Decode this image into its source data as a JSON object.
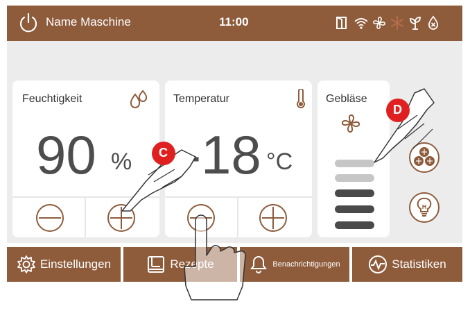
{
  "header": {
    "machine_name": "Name Maschine",
    "time": "11:00",
    "status_icons": [
      "door-icon",
      "wifi-icon",
      "fan-icon",
      "frost-icon",
      "plant-icon",
      "no-water-icon"
    ]
  },
  "cards": {
    "humidity": {
      "title": "Feuchtigkeit",
      "value": "90",
      "unit": "%"
    },
    "temperature": {
      "title": "Temperatur",
      "value": "-18",
      "unit": "°C"
    },
    "fan": {
      "title": "Gebläse",
      "level_bars": 5,
      "active_bars": 3
    }
  },
  "callouts": {
    "c": "C",
    "d": "D"
  },
  "nav": {
    "settings": "Einstellungen",
    "recipes": "Rezepte",
    "notifications": "Benachrichtigungen",
    "statistics": "Statistiken"
  },
  "colors": {
    "brand": "#8e5b3b",
    "accent_red": "#e02020",
    "panel": "#ececec"
  }
}
